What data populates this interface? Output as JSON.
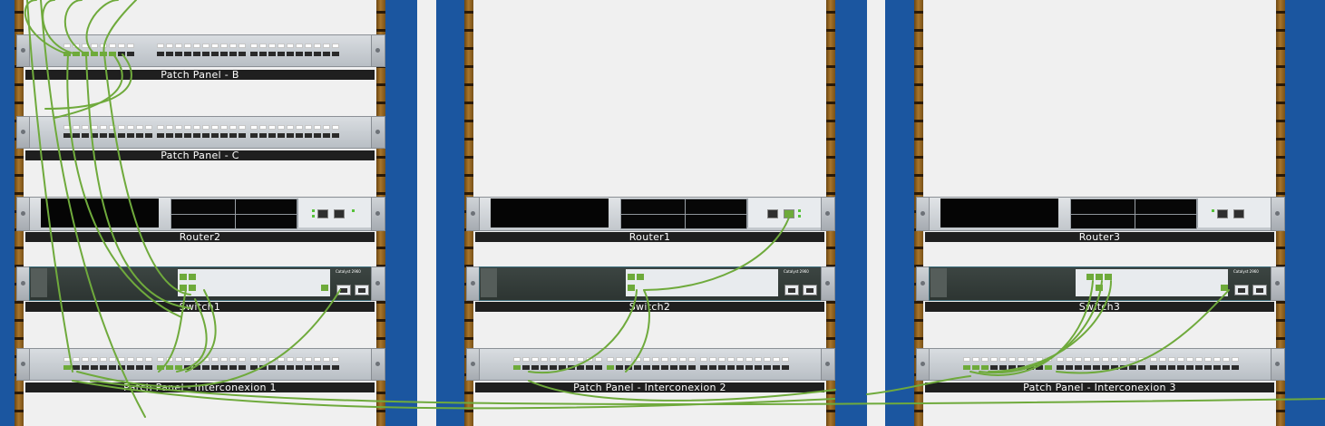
{
  "rack1": {
    "patch_b": "Patch Panel - B",
    "patch_c": "Patch Panel - C",
    "router": "Router2",
    "switch": "Switch1",
    "patch_inter": "Patch Panel - Interconexion 1"
  },
  "rack2": {
    "router": "Router1",
    "switch": "Switch2",
    "patch_inter": "Patch Panel - Interconexion 2"
  },
  "rack3": {
    "router": "Router3",
    "switch": "Switch3",
    "patch_inter": "Patch Panel - Interconexion 3"
  },
  "switch_brand": "Catalyst 2960",
  "colors": {
    "rack_post": "#1b56a0",
    "rail": "#a8752a",
    "cable": "#6faa3c",
    "background": "#f0f0f0"
  }
}
